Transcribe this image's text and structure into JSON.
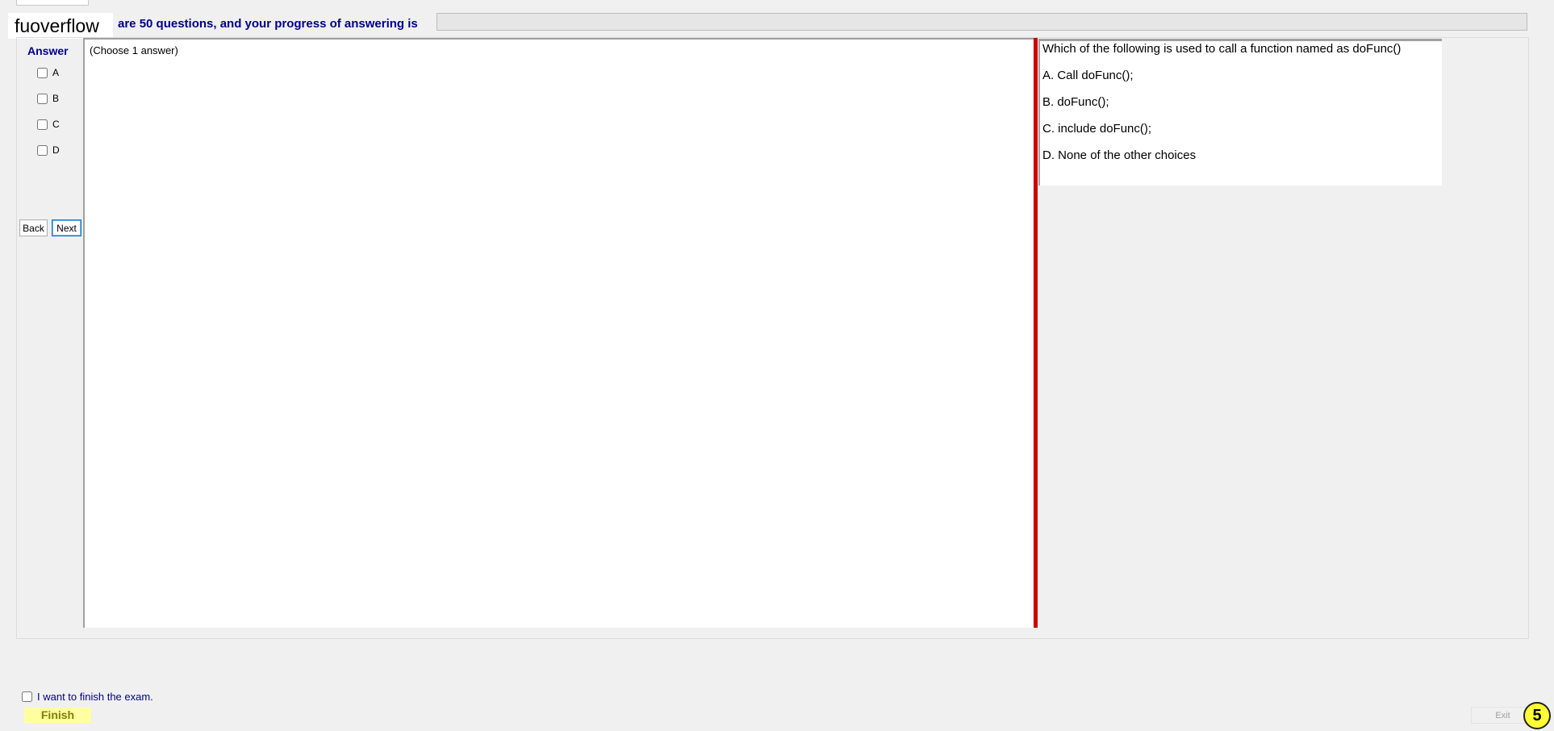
{
  "header": {
    "logo": "fuoverflow",
    "info_text": "are 50 questions, and your progress of answering is",
    "progress_percent": 0
  },
  "answer_panel": {
    "title": "Answer",
    "options": [
      "A",
      "B",
      "C",
      "D"
    ],
    "back_label": "Back",
    "next_label": "Next"
  },
  "answer_pane": {
    "hint": "(Choose 1 answer)"
  },
  "question": {
    "text": "Which of the following is used to call a function named as doFunc()",
    "choices": [
      "A.  Call doFunc();",
      "B.  doFunc();",
      "C.  include doFunc();",
      "D.  None of the other choices"
    ]
  },
  "footer": {
    "finish_check_label": "I want to finish the exam.",
    "finish_label": "Finish",
    "exit_label": "Exit",
    "badge": "5"
  },
  "colors": {
    "accent_text": "#00008b",
    "splitter": "#cc0000",
    "finish_bg": "#ffffa0",
    "badge_bg": "#ffff33"
  }
}
